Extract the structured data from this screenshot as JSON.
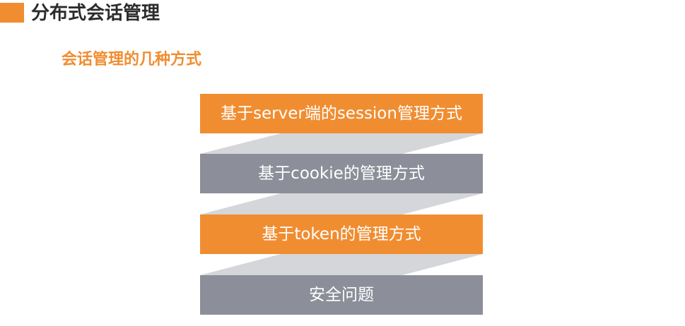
{
  "header": {
    "title": "分布式会话管理"
  },
  "section": {
    "subtitle": "会话管理的几种方式"
  },
  "diagram": {
    "items": [
      {
        "label": "基于server端的session管理方式",
        "color": "#f08d31"
      },
      {
        "label": "基于cookie的管理方式",
        "color": "#8c8e99"
      },
      {
        "label": "基于token的管理方式",
        "color": "#f08d31"
      },
      {
        "label": "安全问题",
        "color": "#8c8e99"
      }
    ]
  },
  "colors": {
    "accent": "#f08d31",
    "gray_block": "#8c8e99",
    "connector": "#d5d6da",
    "title_text": "#2b2b2b"
  }
}
